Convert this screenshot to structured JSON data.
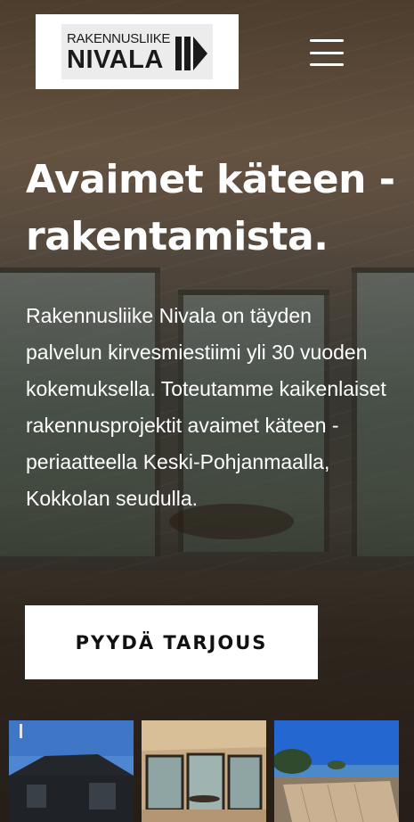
{
  "brand": {
    "logo_top": "RAKENNUSLIIKE",
    "logo_main": "NIVALA"
  },
  "nav": {
    "menu_icon": "hamburger-menu-icon"
  },
  "hero": {
    "title": "Avaimet käteen -rakentamista.",
    "description": "Rakennusliike Nivala on täyden palvelun kirvesmiestiimi yli 30 vuoden kokemuksella. Toteutamme kaikenlaiset rakennusprojektit avaimet käteen -periaatteella Keski-Pohjanmaalla, Kokkolan seudulla.",
    "cta_label": "PYYDÄ TARJOUS"
  },
  "gallery": {
    "items": [
      {
        "name": "dark-house-exterior-photo"
      },
      {
        "name": "interior-windows-photo"
      },
      {
        "name": "wooden-deck-seaview-photo"
      }
    ]
  },
  "colors": {
    "cta_background": "#ffffff",
    "text_light": "#ffffff",
    "logo_dark": "#1a1a1a"
  }
}
